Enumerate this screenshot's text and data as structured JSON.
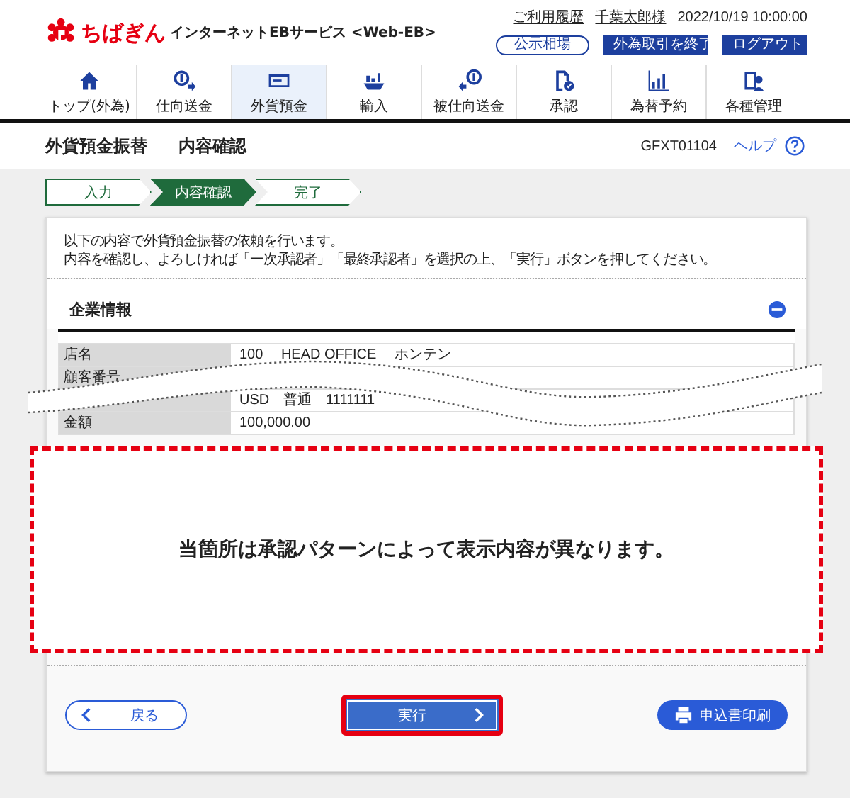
{
  "header": {
    "logo": "ちばぎん",
    "service": "インターネットEBサービス <Web-EB>",
    "links": [
      "ご利用履歴",
      "千葉太郎様"
    ],
    "datetime": "2022/10/19 10:00:00",
    "buttons": [
      {
        "label": "公示相場",
        "kind": "outline"
      },
      {
        "label": "外為取引を終了",
        "kind": "solid"
      },
      {
        "label": "ログアウト",
        "kind": "solid"
      }
    ]
  },
  "nav": [
    {
      "label": "トップ(外為)",
      "selected": false
    },
    {
      "label": "仕向送金",
      "selected": false
    },
    {
      "label": "外貨預金",
      "selected": true
    },
    {
      "label": "輸入",
      "selected": false
    },
    {
      "label": "被仕向送金",
      "selected": false
    },
    {
      "label": "承認",
      "selected": false
    },
    {
      "label": "為替予約",
      "selected": false
    },
    {
      "label": "各種管理",
      "selected": false
    }
  ],
  "page": {
    "title": "外貨預金振替",
    "subtitle": "内容確認",
    "code": "GFXT01104",
    "help": "ヘルプ"
  },
  "steps": [
    {
      "label": "入力",
      "selected": false
    },
    {
      "label": "内容確認",
      "selected": true
    },
    {
      "label": "完了",
      "selected": false
    }
  ],
  "intro": [
    "以下の内容で外貨預金振替の依頼を行います。",
    "内容を確認し、よろしければ「一次承認者」「最終承認者」を選択の上、「実行」ボタンを押してください。"
  ],
  "section": {
    "title": "企業情報",
    "expanded": true
  },
  "table": [
    {
      "label": "店名",
      "value": "100　 HEAD OFFICE 　ホンテン"
    },
    {
      "label": "顧客番号"
    },
    {
      "value": "USD　普通　1111111"
    },
    {
      "label": "金額",
      "value": "100,000.00"
    }
  ],
  "notice": "当箇所は承認パターンによって表示内容が異なります。",
  "buttons": {
    "back": "戻る",
    "execute": "実行",
    "print": "申込書印刷"
  }
}
